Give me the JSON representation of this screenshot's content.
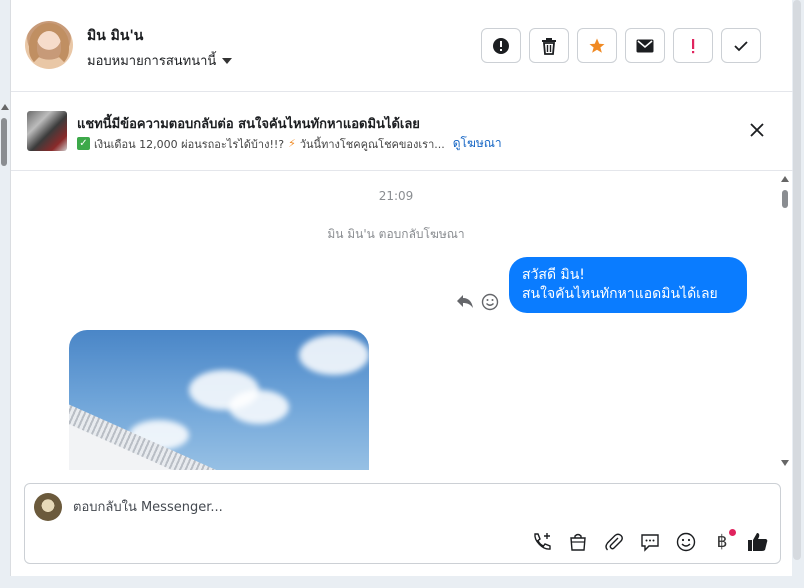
{
  "header": {
    "name": "มิน มิน'น",
    "assign_label": "มอบหมายการสนทนานี้"
  },
  "actions": [
    {
      "name": "alert-icon"
    },
    {
      "name": "trash-icon"
    },
    {
      "name": "star-icon"
    },
    {
      "name": "mail-icon"
    },
    {
      "name": "exclamation-icon"
    },
    {
      "name": "check-icon"
    }
  ],
  "ad": {
    "title": "แชทนี้มีข้อความตอบกลับต่อ สนใจคันไหนทักหาแอดมินได้เลย",
    "sub_a": "เงินเดือน 12,000 ผ่อนรถอะไรได้บ้าง!!?",
    "sub_b": "วันนี้ทางโชคคูณโชคของเรา...",
    "link": "ดูโฆษณา"
  },
  "chat": {
    "time": "21:09",
    "system_message": "มิน มิน'น ตอบกลับโฆษณา",
    "bubble_line1": "สวัสดี มิน!",
    "bubble_line2": "สนใจคันไหนทักหาแอดมินได้เลย"
  },
  "composer": {
    "placeholder": "ตอบกลับใน Messenger...",
    "tools": [
      "call-add-icon",
      "shop-bag-icon",
      "paperclip-icon",
      "chat-bubble-icon",
      "emoji-icon",
      "baht-icon",
      "thumbs-up-icon"
    ],
    "baht_symbol": "฿"
  },
  "colors": {
    "accent": "#0a7cff",
    "star": "#f08a24",
    "exclamation": "#e0245e",
    "link": "#1666c5"
  }
}
